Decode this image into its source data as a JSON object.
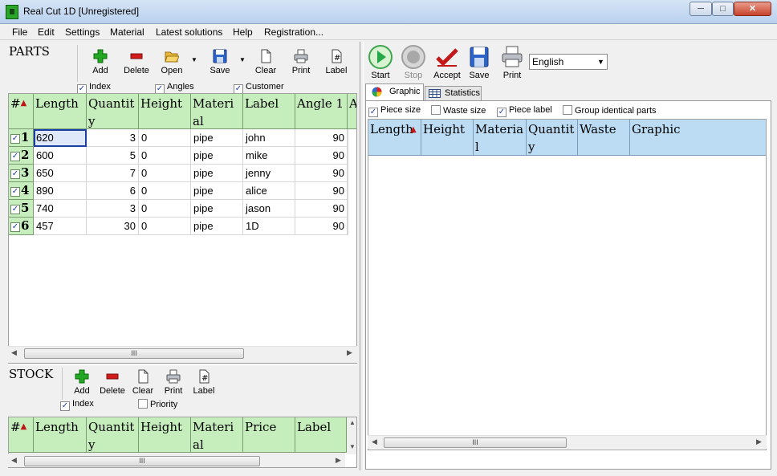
{
  "window": {
    "title": "Real Cut 1D [Unregistered]",
    "controls": [
      "─",
      "□",
      "✕"
    ]
  },
  "menu": [
    "File",
    "Edit",
    "Settings",
    "Material",
    "Latest solutions",
    "Help",
    "Registration..."
  ],
  "parts": {
    "title": "PARTS",
    "toolbar": {
      "add": "Add",
      "delete": "Delete",
      "open": "Open",
      "save": "Save",
      "clear": "Clear",
      "print": "Print",
      "label": "Label"
    },
    "options": {
      "index": "Index",
      "angles": "Angles",
      "customer": "Customer"
    },
    "columns": [
      "#",
      "Length",
      "Quantity",
      "Height",
      "Material",
      "Label",
      "Angle 1",
      "A"
    ],
    "rows": [
      {
        "index": "1",
        "length": "620",
        "quantity": "3",
        "height": "0",
        "material": "pipe",
        "label": "john",
        "angle1": "90"
      },
      {
        "index": "2",
        "length": "600",
        "quantity": "5",
        "height": "0",
        "material": "pipe",
        "label": "mike",
        "angle1": "90"
      },
      {
        "index": "3",
        "length": "650",
        "quantity": "7",
        "height": "0",
        "material": "pipe",
        "label": "jenny",
        "angle1": "90"
      },
      {
        "index": "4",
        "length": "890",
        "quantity": "6",
        "height": "0",
        "material": "pipe",
        "label": "alice",
        "angle1": "90"
      },
      {
        "index": "5",
        "length": "740",
        "quantity": "3",
        "height": "0",
        "material": "pipe",
        "label": "jason",
        "angle1": "90"
      },
      {
        "index": "6",
        "length": "457",
        "quantity": "30",
        "height": "0",
        "material": "pipe",
        "label": "1D",
        "angle1": "90"
      }
    ],
    "scroll_grip": "III"
  },
  "stock": {
    "title": "STOCK",
    "toolbar": {
      "add": "Add",
      "delete": "Delete",
      "clear": "Clear",
      "print": "Print",
      "label": "Label"
    },
    "options": {
      "index": "Index",
      "priority": "Priority"
    },
    "columns": [
      "#",
      "Length",
      "Quantity",
      "Height",
      "Material",
      "Price",
      "Label"
    ],
    "scroll_grip": "III"
  },
  "solver": {
    "toolbar": {
      "start": "Start",
      "stop": "Stop",
      "accept": "Accept",
      "save": "Save",
      "print": "Print"
    },
    "language": "English",
    "tabs": {
      "graphic": "Graphic",
      "statistics": "Statistics"
    },
    "options": {
      "piece_size": "Piece size",
      "waste_size": "Waste size",
      "piece_label": "Piece label",
      "group_identical": "Group identical parts"
    },
    "columns": [
      "Length",
      "Height",
      "Material",
      "Quantity",
      "Waste",
      "Graphic"
    ],
    "scroll_grip": "III"
  },
  "colors": {
    "parts_header": "#c6eebd",
    "result_header": "#bcdcf4",
    "accent_green": "#22a822",
    "accent_red": "#d21a1a"
  }
}
